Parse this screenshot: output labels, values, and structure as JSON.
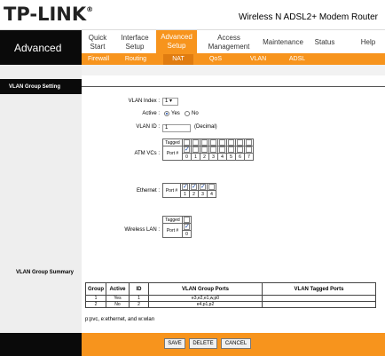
{
  "header": {
    "logo": "TP-LINK",
    "logo_mark": "®",
    "model": "Wireless N ADSL2+ Modem Router"
  },
  "nav": {
    "brand": "Advanced",
    "items": [
      {
        "label": "Quick\nStart"
      },
      {
        "label": "Interface\nSetup"
      },
      {
        "label": "Advanced\nSetup"
      },
      {
        "label": "Access\nManagement"
      },
      {
        "label": "Maintenance"
      },
      {
        "label": "Status"
      },
      {
        "label": "Help"
      }
    ],
    "subitems": [
      {
        "label": "Firewall"
      },
      {
        "label": "Routing"
      },
      {
        "label": "NAT"
      },
      {
        "label": "QoS"
      },
      {
        "label": "VLAN"
      },
      {
        "label": "ADSL"
      }
    ]
  },
  "section": {
    "title": "VLAN Group Setting"
  },
  "form": {
    "vlan_index_label": "VLAN Index :",
    "vlan_index_value": "1",
    "active_label": "Active :",
    "yes": "Yes",
    "no": "No",
    "vlan_id_label": "VLAN ID :",
    "vlan_id_value": "1",
    "vlan_id_hint": "(Decimal)",
    "atm_label": "ATM VCs :",
    "ethernet_label": "Ethernet :",
    "wireless_label": "Wireless LAN :",
    "tagged": "Tagged",
    "port": "Port #",
    "atm_ports": [
      "0",
      "1",
      "2",
      "3",
      "4",
      "5",
      "6",
      "7"
    ],
    "atm_port_checked": [
      true,
      false,
      false,
      false,
      false,
      false,
      false,
      false
    ],
    "eth_ports": [
      "1",
      "2",
      "3",
      "4"
    ],
    "eth_port_checked": [
      true,
      true,
      true,
      false
    ],
    "wl_ports": [
      "0"
    ],
    "wl_port_checked": [
      true
    ]
  },
  "summary": {
    "title": "VLAN Group Summary",
    "headers": [
      "Group",
      "Active",
      "ID",
      "VLAN Group Ports",
      "VLAN Tagged Ports"
    ],
    "rows": [
      [
        "1",
        "Yes",
        "1",
        "e3,e2,e1,w,p0",
        ""
      ],
      [
        "2",
        "No",
        "2",
        "e4,p1,p2",
        ""
      ]
    ],
    "note": "p:pvc, e:ethernet, and w:wlan"
  },
  "buttons": {
    "save": "SAVE",
    "delete": "DELETE",
    "cancel": "CANCEL"
  },
  "colors": {
    "accent": "#f7941d",
    "dark": "#0a0a0a"
  }
}
